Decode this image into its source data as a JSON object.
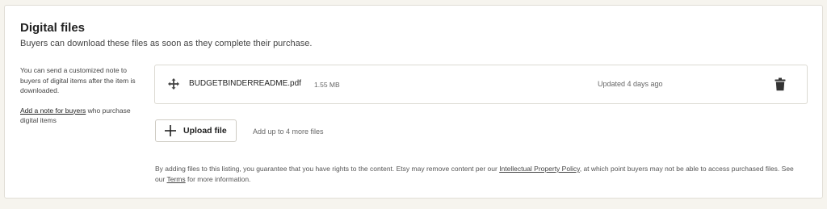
{
  "section": {
    "title": "Digital files",
    "subtitle": "Buyers can download these files as soon as they complete their purchase."
  },
  "sidebar": {
    "note": "You can send a customized note to buyers of digital items after the item is downloaded.",
    "link_label": "Add a note for buyers",
    "link_suffix": " who purchase digital items"
  },
  "files": [
    {
      "name": "BUDGETBINDERREADME.pdf",
      "size": "1.55 MB",
      "updated": "Updated 4 days ago",
      "move_icon": "move-arrows-icon",
      "delete_icon": "trash-icon"
    }
  ],
  "upload": {
    "button_label": "Upload file",
    "icon": "plus-icon",
    "hint": "Add up to 4 more files"
  },
  "legal": {
    "part1": "By adding files to this listing, you guarantee that you have rights to the content. Etsy may remove content per our ",
    "policy_link": "Intellectual Property Policy",
    "part2": ", at which point buyers may not be able to access purchased files. See our ",
    "terms_link": "Terms",
    "part3": " for more information."
  },
  "colors": {
    "page_bg": "#f6f4ee",
    "card_bg": "#ffffff",
    "border": "#dcdad2",
    "text": "#222222",
    "muted": "#666666"
  }
}
